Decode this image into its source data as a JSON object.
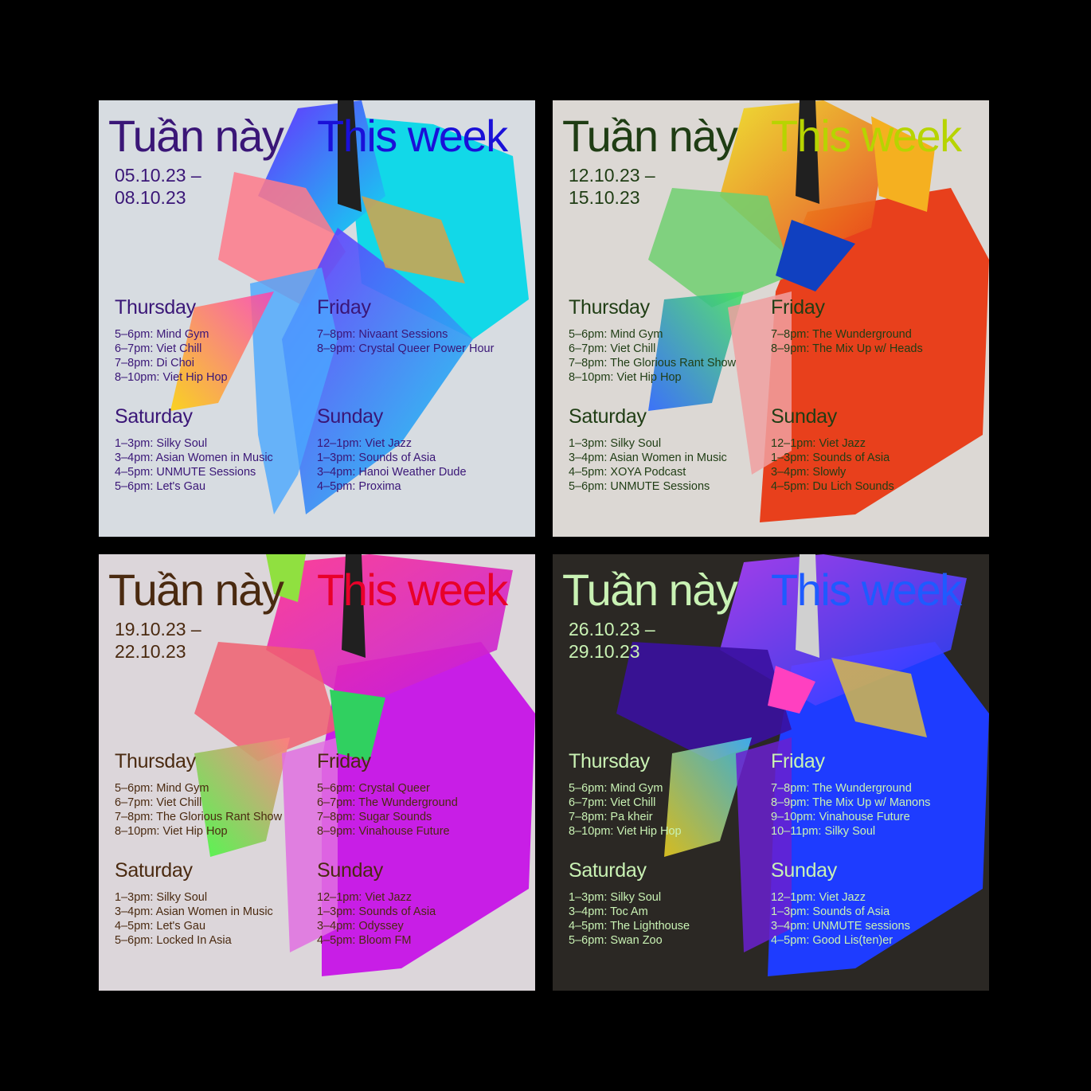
{
  "posters": [
    {
      "title_vi": "Tuần này",
      "title_en": "This week",
      "date_start": "05.10.23 –",
      "date_end": "08.10.23",
      "text_color": "#3a1677",
      "title_en_color": "#1a10d8",
      "bg_color": "#d7dce1",
      "days": {
        "thursday": {
          "name": "Thursday",
          "shows": [
            "5–6pm: Mind Gym",
            "6–7pm: Viet Chill",
            "7–8pm: Di Choi",
            "8–10pm: Viet Hip Hop"
          ]
        },
        "friday": {
          "name": "Friday",
          "shows": [
            "7–8pm: Nivaant Sessions",
            "8–9pm: Crystal Queer Power Hour"
          ]
        },
        "saturday": {
          "name": "Saturday",
          "shows": [
            "1–3pm: Silky Soul",
            "3–4pm: Asian Women in Music",
            "4–5pm: UNMUTE Sessions",
            "5–6pm: Let's Gau"
          ]
        },
        "sunday": {
          "name": "Sunday",
          "shows": [
            "12–1pm: Viet Jazz",
            "1–3pm: Sounds of Asia",
            "3–4pm: Hanoi Weather Dude",
            "4–5pm: Proxima"
          ]
        }
      }
    },
    {
      "title_vi": "Tuần này",
      "title_en": "This week",
      "date_start": "12.10.23 –",
      "date_end": "15.10.23",
      "text_color": "#1f3d14",
      "title_en_color": "#b7d400",
      "bg_color": "#dcd8d4",
      "days": {
        "thursday": {
          "name": "Thursday",
          "shows": [
            "5–6pm: Mind Gym",
            "6–7pm: Viet Chill",
            "7–8pm: The Glorious Rant Show",
            "8–10pm: Viet Hip Hop"
          ]
        },
        "friday": {
          "name": "Friday",
          "shows": [
            "7–8pm: The Wunderground",
            "8–9pm: The Mix Up w/ Heads"
          ]
        },
        "saturday": {
          "name": "Saturday",
          "shows": [
            "1–3pm: Silky Soul",
            "3–4pm: Asian Women in Music",
            "4–5pm: XOYA Podcast",
            "5–6pm: UNMUTE Sessions"
          ]
        },
        "sunday": {
          "name": "Sunday",
          "shows": [
            "12–1pm: Viet Jazz",
            "1–3pm: Sounds of Asia",
            "3–4pm: Slowly",
            "4–5pm: Du Lich Sounds"
          ]
        }
      }
    },
    {
      "title_vi": "Tuần này",
      "title_en": "This week",
      "date_start": "19.10.23 –",
      "date_end": "22.10.23",
      "text_color": "#4a2a10",
      "title_en_color": "#e8002a",
      "bg_color": "#dcd6da",
      "days": {
        "thursday": {
          "name": "Thursday",
          "shows": [
            "5–6pm: Mind Gym",
            "6–7pm: Viet Chill",
            "7–8pm: The Glorious Rant Show",
            "8–10pm: Viet Hip Hop"
          ]
        },
        "friday": {
          "name": "Friday",
          "shows": [
            "5–6pm: Crystal Queer",
            "6–7pm: The Wunderground",
            "7–8pm: Sugar Sounds",
            "8–9pm: Vinahouse Future"
          ]
        },
        "saturday": {
          "name": "Saturday",
          "shows": [
            "1–3pm: Silky Soul",
            "3–4pm: Asian Women in Music",
            "4–5pm: Let's Gau",
            "5–6pm: Locked In Asia"
          ]
        },
        "sunday": {
          "name": "Sunday",
          "shows": [
            "12–1pm: Viet Jazz",
            "1–3pm: Sounds of Asia",
            "3–4pm: Odyssey",
            "4–5pm: Bloom FM"
          ]
        }
      }
    },
    {
      "title_vi": "Tuần này",
      "title_en": "This week",
      "date_start": "26.10.23 –",
      "date_end": "29.10.23",
      "text_color": "#c9f2b4",
      "title_en_color": "#1e5bff",
      "bg_color": "#2b2824",
      "days": {
        "thursday": {
          "name": "Thursday",
          "shows": [
            "5–6pm: Mind Gym",
            "6–7pm: Viet Chill",
            "7–8pm: Pa kheir",
            "8–10pm: Viet Hip Hop"
          ]
        },
        "friday": {
          "name": "Friday",
          "shows": [
            "7–8pm: The Wunderground",
            "8–9pm: The Mix Up w/ Manons",
            "9–10pm: Vinahouse Future",
            "10–11pm: Silky Soul"
          ]
        },
        "saturday": {
          "name": "Saturday",
          "shows": [
            "1–3pm: Silky Soul",
            "3–4pm: Toc Am",
            "4–5pm: The Lighthouse",
            "5–6pm: Swan Zoo"
          ]
        },
        "sunday": {
          "name": "Sunday",
          "shows": [
            "12–1pm: Viet Jazz",
            "1–3pm: Sounds of Asia",
            "3–4pm: UNMUTE sessions",
            "4–5pm: Good Lis(ten)er"
          ]
        }
      }
    }
  ]
}
